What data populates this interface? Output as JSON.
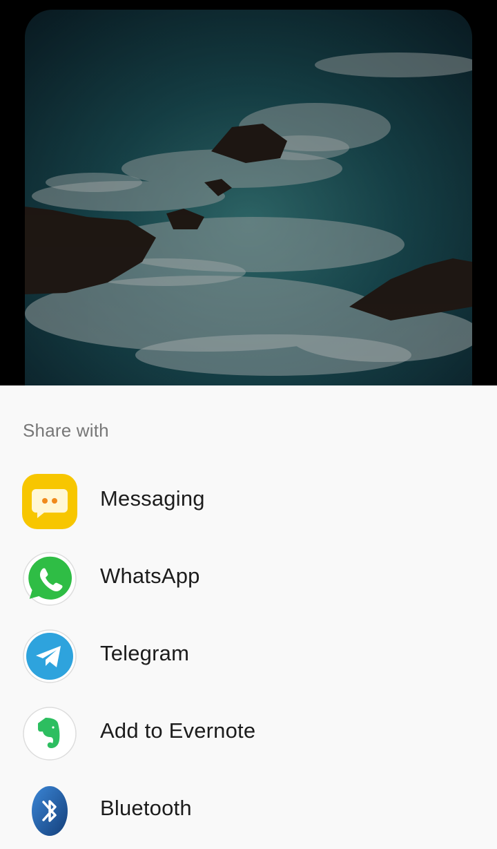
{
  "preview": {
    "image_description_icon": "ocean-waves-rocks-image"
  },
  "share_sheet": {
    "title": "Share with",
    "items": [
      {
        "label": "Messaging",
        "icon": "messaging-icon"
      },
      {
        "label": "WhatsApp",
        "icon": "whatsapp-icon"
      },
      {
        "label": "Telegram",
        "icon": "telegram-icon"
      },
      {
        "label": "Add to Evernote",
        "icon": "evernote-icon"
      },
      {
        "label": "Bluetooth",
        "icon": "bluetooth-icon"
      }
    ]
  },
  "colors": {
    "sheet_background": "#f9f9f9",
    "title_text": "#777777",
    "label_text": "#1c1c1c",
    "messaging_yellow": "#f7c600",
    "whatsapp_green": "#2fbd45",
    "telegram_blue": "#2ea3dd",
    "evernote_green": "#2dbe60",
    "bluetooth_blue": "#1f5fa8"
  }
}
